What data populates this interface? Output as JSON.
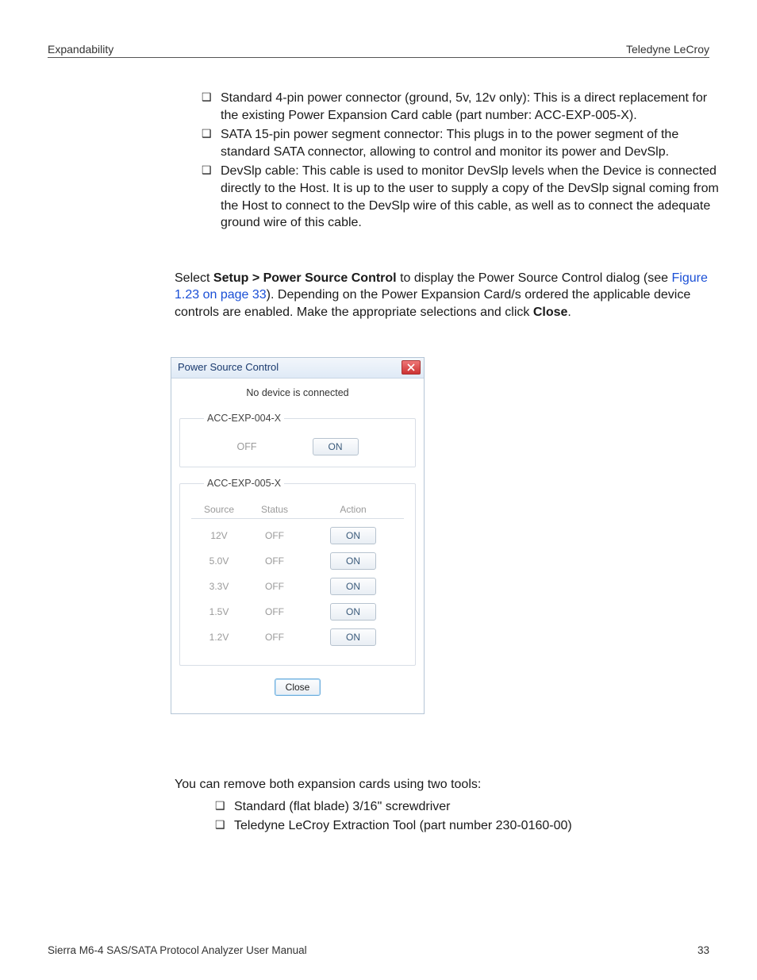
{
  "header": {
    "left": "Expandability",
    "right": "Teledyne LeCroy"
  },
  "bullets1": [
    "Standard 4-pin power connector (ground, 5v, 12v only): This is a direct replacement for the existing Power Expansion Card cable (part number: ACC-EXP-005-X).",
    "SATA 15-pin power segment connector: This plugs in to the power segment of the standard SATA connector, allowing to control and monitor its power and DevSlp.",
    "DevSlp cable: This cable is used to monitor DevSlp levels when the Device is connected directly to the Host. It is up to the user to supply a copy of the DevSlp signal coming from the Host to connect to the DevSlp wire of this cable, as well as to connect the adequate ground wire of this cable."
  ],
  "para1": {
    "pre": "Select ",
    "menu": "Setup > Power Source Control",
    "mid": " to display the Power Source Control dialog (see ",
    "link": "Figure 1.23 on page 33",
    "post1": "). Depending on the Power Expansion Card/s ordered the applicable device controls are enabled. Make the appropriate selections and click ",
    "close": "Close",
    "post2": "."
  },
  "dialog": {
    "title": "Power Source Control",
    "no_device": "No device is connected",
    "group004": {
      "legend": "ACC-EXP-004-X",
      "status": "OFF",
      "action": "ON"
    },
    "group005": {
      "legend": "ACC-EXP-005-X",
      "columns": {
        "source": "Source",
        "status": "Status",
        "action": "Action"
      },
      "rows": [
        {
          "source": "12V",
          "status": "OFF",
          "action": "ON"
        },
        {
          "source": "5.0V",
          "status": "OFF",
          "action": "ON"
        },
        {
          "source": "3.3V",
          "status": "OFF",
          "action": "ON"
        },
        {
          "source": "1.5V",
          "status": "OFF",
          "action": "ON"
        },
        {
          "source": "1.2V",
          "status": "OFF",
          "action": "ON"
        }
      ]
    },
    "close_btn": "Close"
  },
  "para2": "You can remove both expansion cards using two tools:",
  "bullets2": [
    "Standard (flat blade) 3/16\" screwdriver",
    "Teledyne LeCroy Extraction Tool (part number 230-0160-00)"
  ],
  "footer": {
    "left": "Sierra M6-4 SAS/SATA Protocol Analyzer User Manual",
    "right": "33"
  }
}
